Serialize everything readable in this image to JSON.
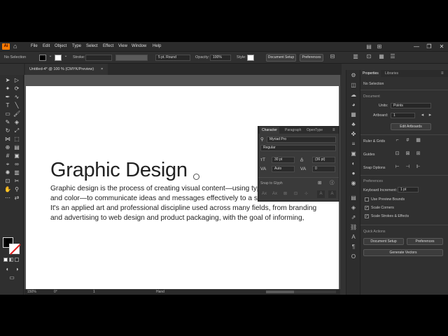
{
  "app": {
    "logo": "Ai",
    "home_icon": "home-icon"
  },
  "menu": [
    "File",
    "Edit",
    "Object",
    "Type",
    "Select",
    "Effect",
    "View",
    "Window",
    "Help"
  ],
  "window_controls": [
    "—",
    "❐",
    "✕"
  ],
  "control_bar": {
    "selection": "No Selection",
    "stroke_label": "Stroke:",
    "brush": "5 pt. Round",
    "opacity_label": "Opacity:",
    "opacity": "100%",
    "style_label": "Style:",
    "doc_setup": "Document Setup",
    "preferences": "Preferences"
  },
  "document": {
    "tab_title": "Untitled-4* @ 100 % (CMYK/Preview)",
    "close": "×"
  },
  "artwork": {
    "heading": "Graphic Design",
    "paragraph": [
      "Graphic design is the process of creating visual content—using typography, images,",
      "and color—to communicate ideas and messages effectively to a specific audience.",
      "It's an applied art and professional discipline used across many fields, from branding",
      "and advertising to web design and product packaging, with the goal of informing,"
    ]
  },
  "status": {
    "zoom": "150%",
    "rotation": "0°",
    "artboard": "1",
    "tool": "Hand"
  },
  "character_panel": {
    "tabs": [
      "Character",
      "Paragraph",
      "OpenType"
    ],
    "font": "Myriad Pro",
    "style": "Regular",
    "size": "30 pt",
    "leading": "(36 pt)",
    "kerning": "Auto",
    "tracking": "0",
    "snap_label": "Snap to Glyph"
  },
  "properties": {
    "tabs": [
      "Properties",
      "Libraries"
    ],
    "selection": "No Selection",
    "document_label": "Document",
    "units_label": "Units:",
    "units": "Points",
    "artboard_label": "Artboard:",
    "artboard": "1",
    "edit_artboards": "Edit Artboards",
    "ruler_grids": "Ruler & Grids",
    "guides": "Guides",
    "snap_options": "Snap Options",
    "preferences_label": "Preferences",
    "keyboard_increment_label": "Keyboard Increment:",
    "keyboard_increment": "1 pt",
    "use_preview_bounds": "Use Preview Bounds",
    "scale_corners": "Scale Corners",
    "scale_strokes": "Scale Strokes & Effects",
    "quick_actions": "Quick Actions",
    "doc_setup": "Document Setup",
    "prefs_button": "Preferences",
    "generate_vectors": "Generate Vectors"
  }
}
